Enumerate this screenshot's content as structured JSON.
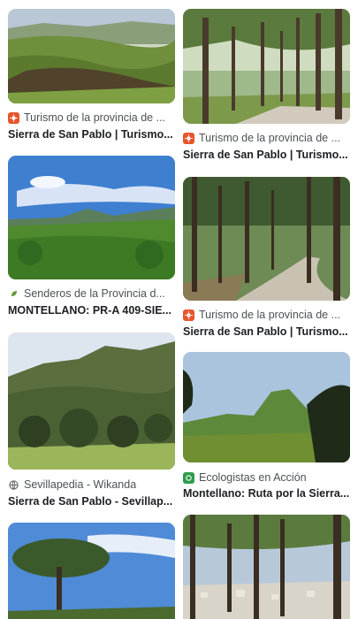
{
  "results": [
    {
      "source": "Turismo de la provincia de ...",
      "title": "Sierra de San Pablo | Turismo...",
      "favicon": "turismo-sun-icon",
      "favicon_color": "#e8542b"
    },
    {
      "source": "Turismo de la provincia de ...",
      "title": "Sierra de San Pablo | Turismo...",
      "favicon": "turismo-sun-icon",
      "favicon_color": "#e8542b"
    },
    {
      "source": "Senderos de la Provincia d...",
      "title": "MONTELLANO: PR-A 409-SIE...",
      "favicon": "senderos-leaf-icon",
      "favicon_color": "#6a9a3a"
    },
    {
      "source": "Turismo de la provincia de ...",
      "title": "Sierra de San Pablo | Turismo...",
      "favicon": "turismo-sun-icon",
      "favicon_color": "#e8542b"
    },
    {
      "source": "Sevillapedia - Wikanda",
      "title": "Sierra de San Pablo - Sevillap...",
      "favicon": "globe-icon",
      "favicon_color": "#5f6368"
    },
    {
      "source": "Ecologistas en Acción",
      "title": "Montellano: Ruta por la Sierra...",
      "favicon": "ecologistas-icon",
      "favicon_color": "#2e9c4a"
    }
  ]
}
